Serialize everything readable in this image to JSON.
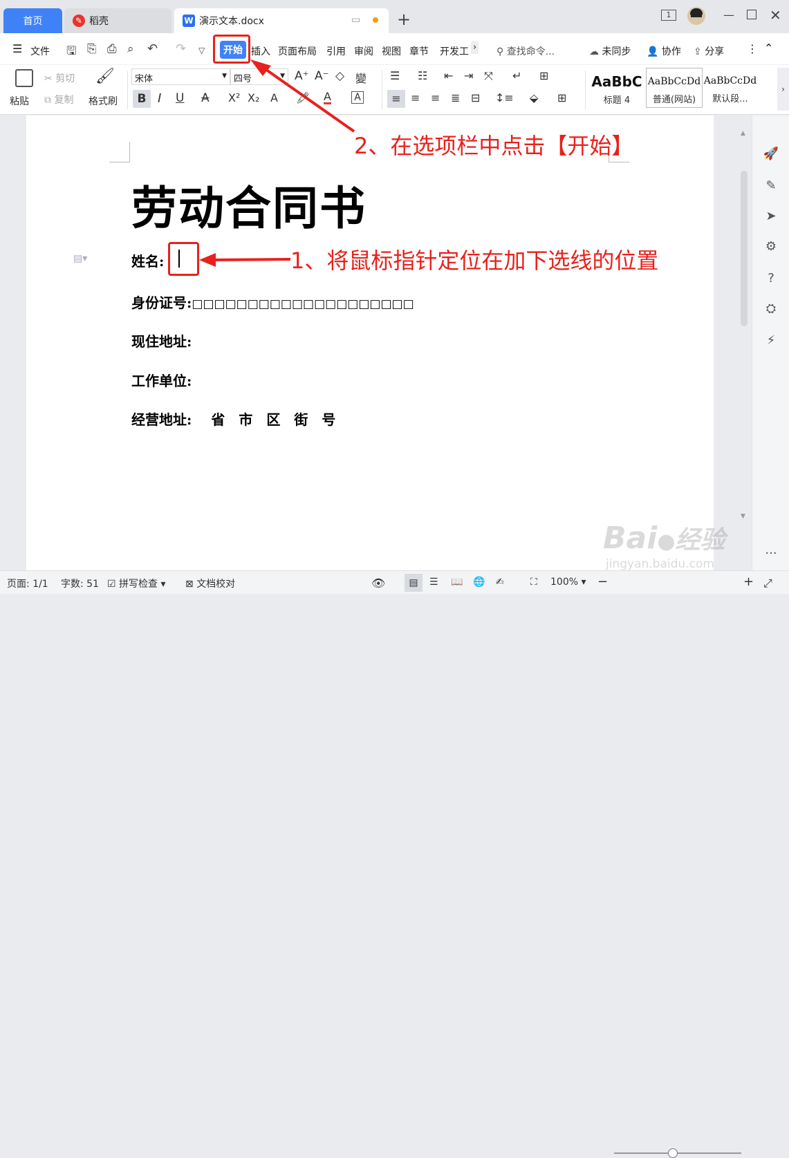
{
  "tabs": {
    "home": "首页",
    "daoke": "稻壳",
    "document": "演示文本.docx"
  },
  "window": {
    "page_indicator": "1"
  },
  "menu": {
    "file": "文件",
    "items": [
      "开始",
      "插入",
      "页面布局",
      "引用",
      "审阅",
      "视图",
      "章节",
      "开发工"
    ],
    "search_placeholder": "查找命令...",
    "sync": "未同步",
    "collab": "协作",
    "share": "分享"
  },
  "ribbon": {
    "paste": "粘贴",
    "cut": "剪切",
    "copy": "复制",
    "format_painter": "格式刷",
    "font_name": "宋体",
    "font_size": "四号",
    "styles": [
      {
        "preview": "AaBbC",
        "name": "标题 4"
      },
      {
        "preview": "AaBbCcDd",
        "name": "普通(网站)"
      },
      {
        "preview": "AaBbCcDd",
        "name": "默认段..."
      }
    ]
  },
  "document": {
    "title": "劳动合同书",
    "fields": {
      "name": "姓名:",
      "id": "身份证号:",
      "id_boxes": "□□□□□□□□□□□□□□□□□□□□",
      "address": "现住地址:",
      "employer": "工作单位:",
      "business_address": "经营地址:",
      "address_parts": "省　市　区　街　号"
    }
  },
  "annotations": {
    "step1": "1、将鼠标指针定位在加下选线的位置",
    "step2": "2、在选项栏中点击【开始】"
  },
  "status": {
    "page": "页面: 1/1",
    "word_count": "字数: 51",
    "spell_check": "拼写检查",
    "proofread": "文档校对",
    "zoom": "100%"
  },
  "watermark": {
    "brand": "Bai",
    "brand2": "经验",
    "url": "jingyan.baidu.com"
  },
  "colors": {
    "accent": "#3f82f7",
    "annotation": "#e8211c"
  }
}
